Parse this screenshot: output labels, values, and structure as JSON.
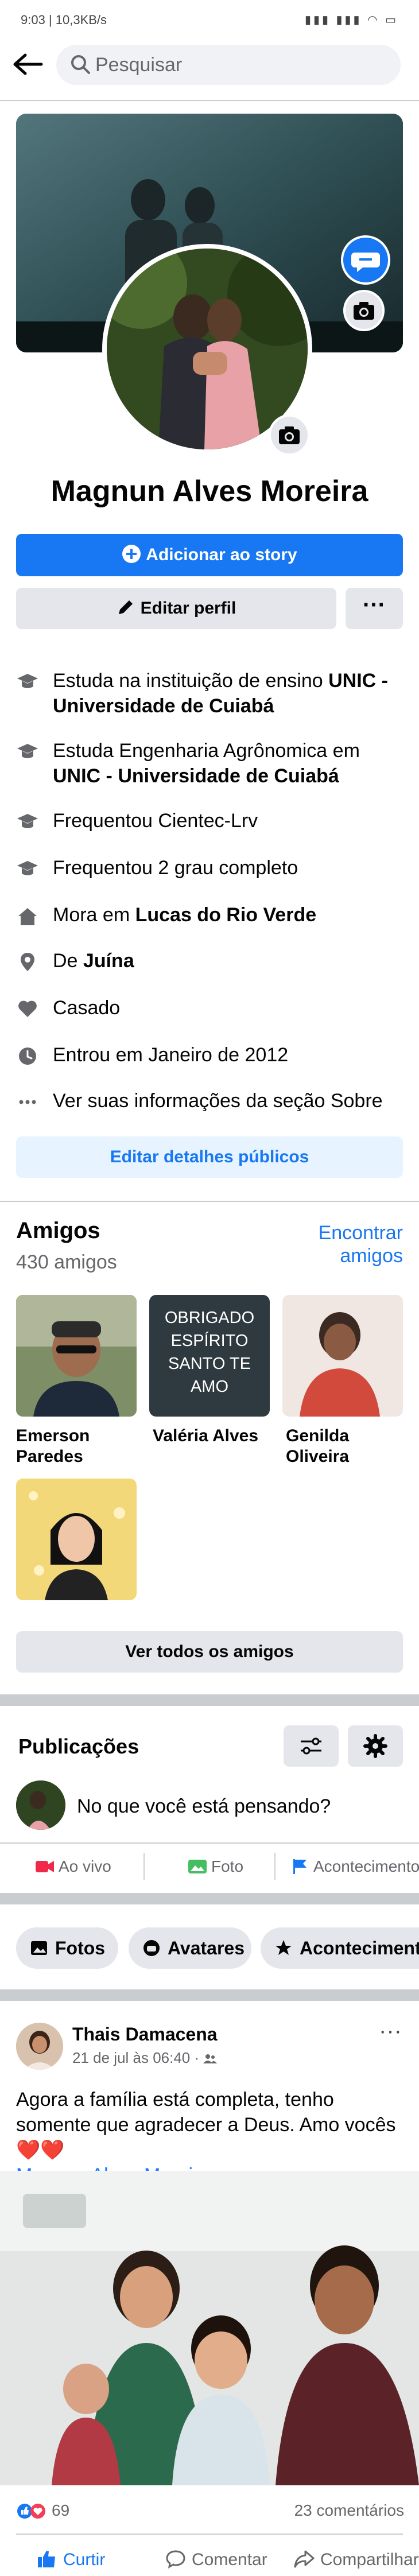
{
  "status_bar": {
    "left": "9:03 | 10,3KB/s",
    "right": "▮▮▮ ▮▮▮ ◠ ▭"
  },
  "search": {
    "placeholder": "Pesquisar"
  },
  "profile": {
    "name": "Magnun Alves Moreira",
    "add_story_label": "Adicionar ao story",
    "edit_profile_label": "Editar perfil",
    "more_label": "···"
  },
  "about": {
    "rows": [
      {
        "icon": "graduation-cap-icon",
        "prefix": "Estuda na instituição de ensino ",
        "bold": "UNIC - Universidade de Cuiabá",
        "suffix": ""
      },
      {
        "icon": "graduation-cap-icon",
        "prefix": "Estuda Engenharia Agrônomica em ",
        "bold": "UNIC - Universidade de Cuiabá",
        "suffix": ""
      },
      {
        "icon": "graduation-cap-icon",
        "prefix": "Frequentou Cientec-Lrv",
        "bold": "",
        "suffix": ""
      },
      {
        "icon": "graduation-cap-icon",
        "prefix": "Frequentou 2 grau completo",
        "bold": "",
        "suffix": ""
      },
      {
        "icon": "home-icon",
        "prefix": "Mora em ",
        "bold": "Lucas do Rio Verde",
        "suffix": ""
      },
      {
        "icon": "location-pin-icon",
        "prefix": "De ",
        "bold": "Juína",
        "suffix": ""
      },
      {
        "icon": "heart-icon",
        "prefix": "Casado",
        "bold": "",
        "suffix": ""
      },
      {
        "icon": "clock-icon",
        "prefix": "Entrou em Janeiro de 2012",
        "bold": "",
        "suffix": ""
      },
      {
        "icon": "ellipsis-icon",
        "prefix": "Ver suas informações da seção Sobre",
        "bold": "",
        "suffix": ""
      }
    ],
    "edit_details_label": "Editar detalhes públicos"
  },
  "friends": {
    "title": "Amigos",
    "count": "430 amigos",
    "find_label": "Encontrar amigos",
    "items": [
      {
        "name": "Emerson Paredes"
      },
      {
        "name": "Valéria Alves",
        "photo_text": "OBRIGADO ESPÍRITO SANTO TE AMO"
      },
      {
        "name": "Genilda Oliveira"
      },
      {
        "name": ""
      }
    ],
    "see_all_label": "Ver todos os amigos"
  },
  "posts_section": {
    "title": "Publicações",
    "composer_placeholder": "No que você está pensando?",
    "actions": [
      "Ao vivo",
      "Foto",
      "Acontecimento"
    ],
    "chips": [
      "Fotos",
      "Avatares",
      "Acontecimentos"
    ]
  },
  "post": {
    "author": "Thais Damacena",
    "meta": "21 de jul às 06:40 · ",
    "text": "Agora a família está completa, tenho somente que agradecer a Deus. Amo vocês ❤️❤️",
    "mention": "Magnun Alves Moreira",
    "reactions_count": "69",
    "comments_count": "23 comentários",
    "actions": [
      "Curtir",
      "Comentar",
      "Compartilhar"
    ]
  },
  "colors": {
    "accent": "#1877f2",
    "secondary_bg": "#e4e6eb",
    "text": "#050505",
    "muted": "#65676b"
  }
}
